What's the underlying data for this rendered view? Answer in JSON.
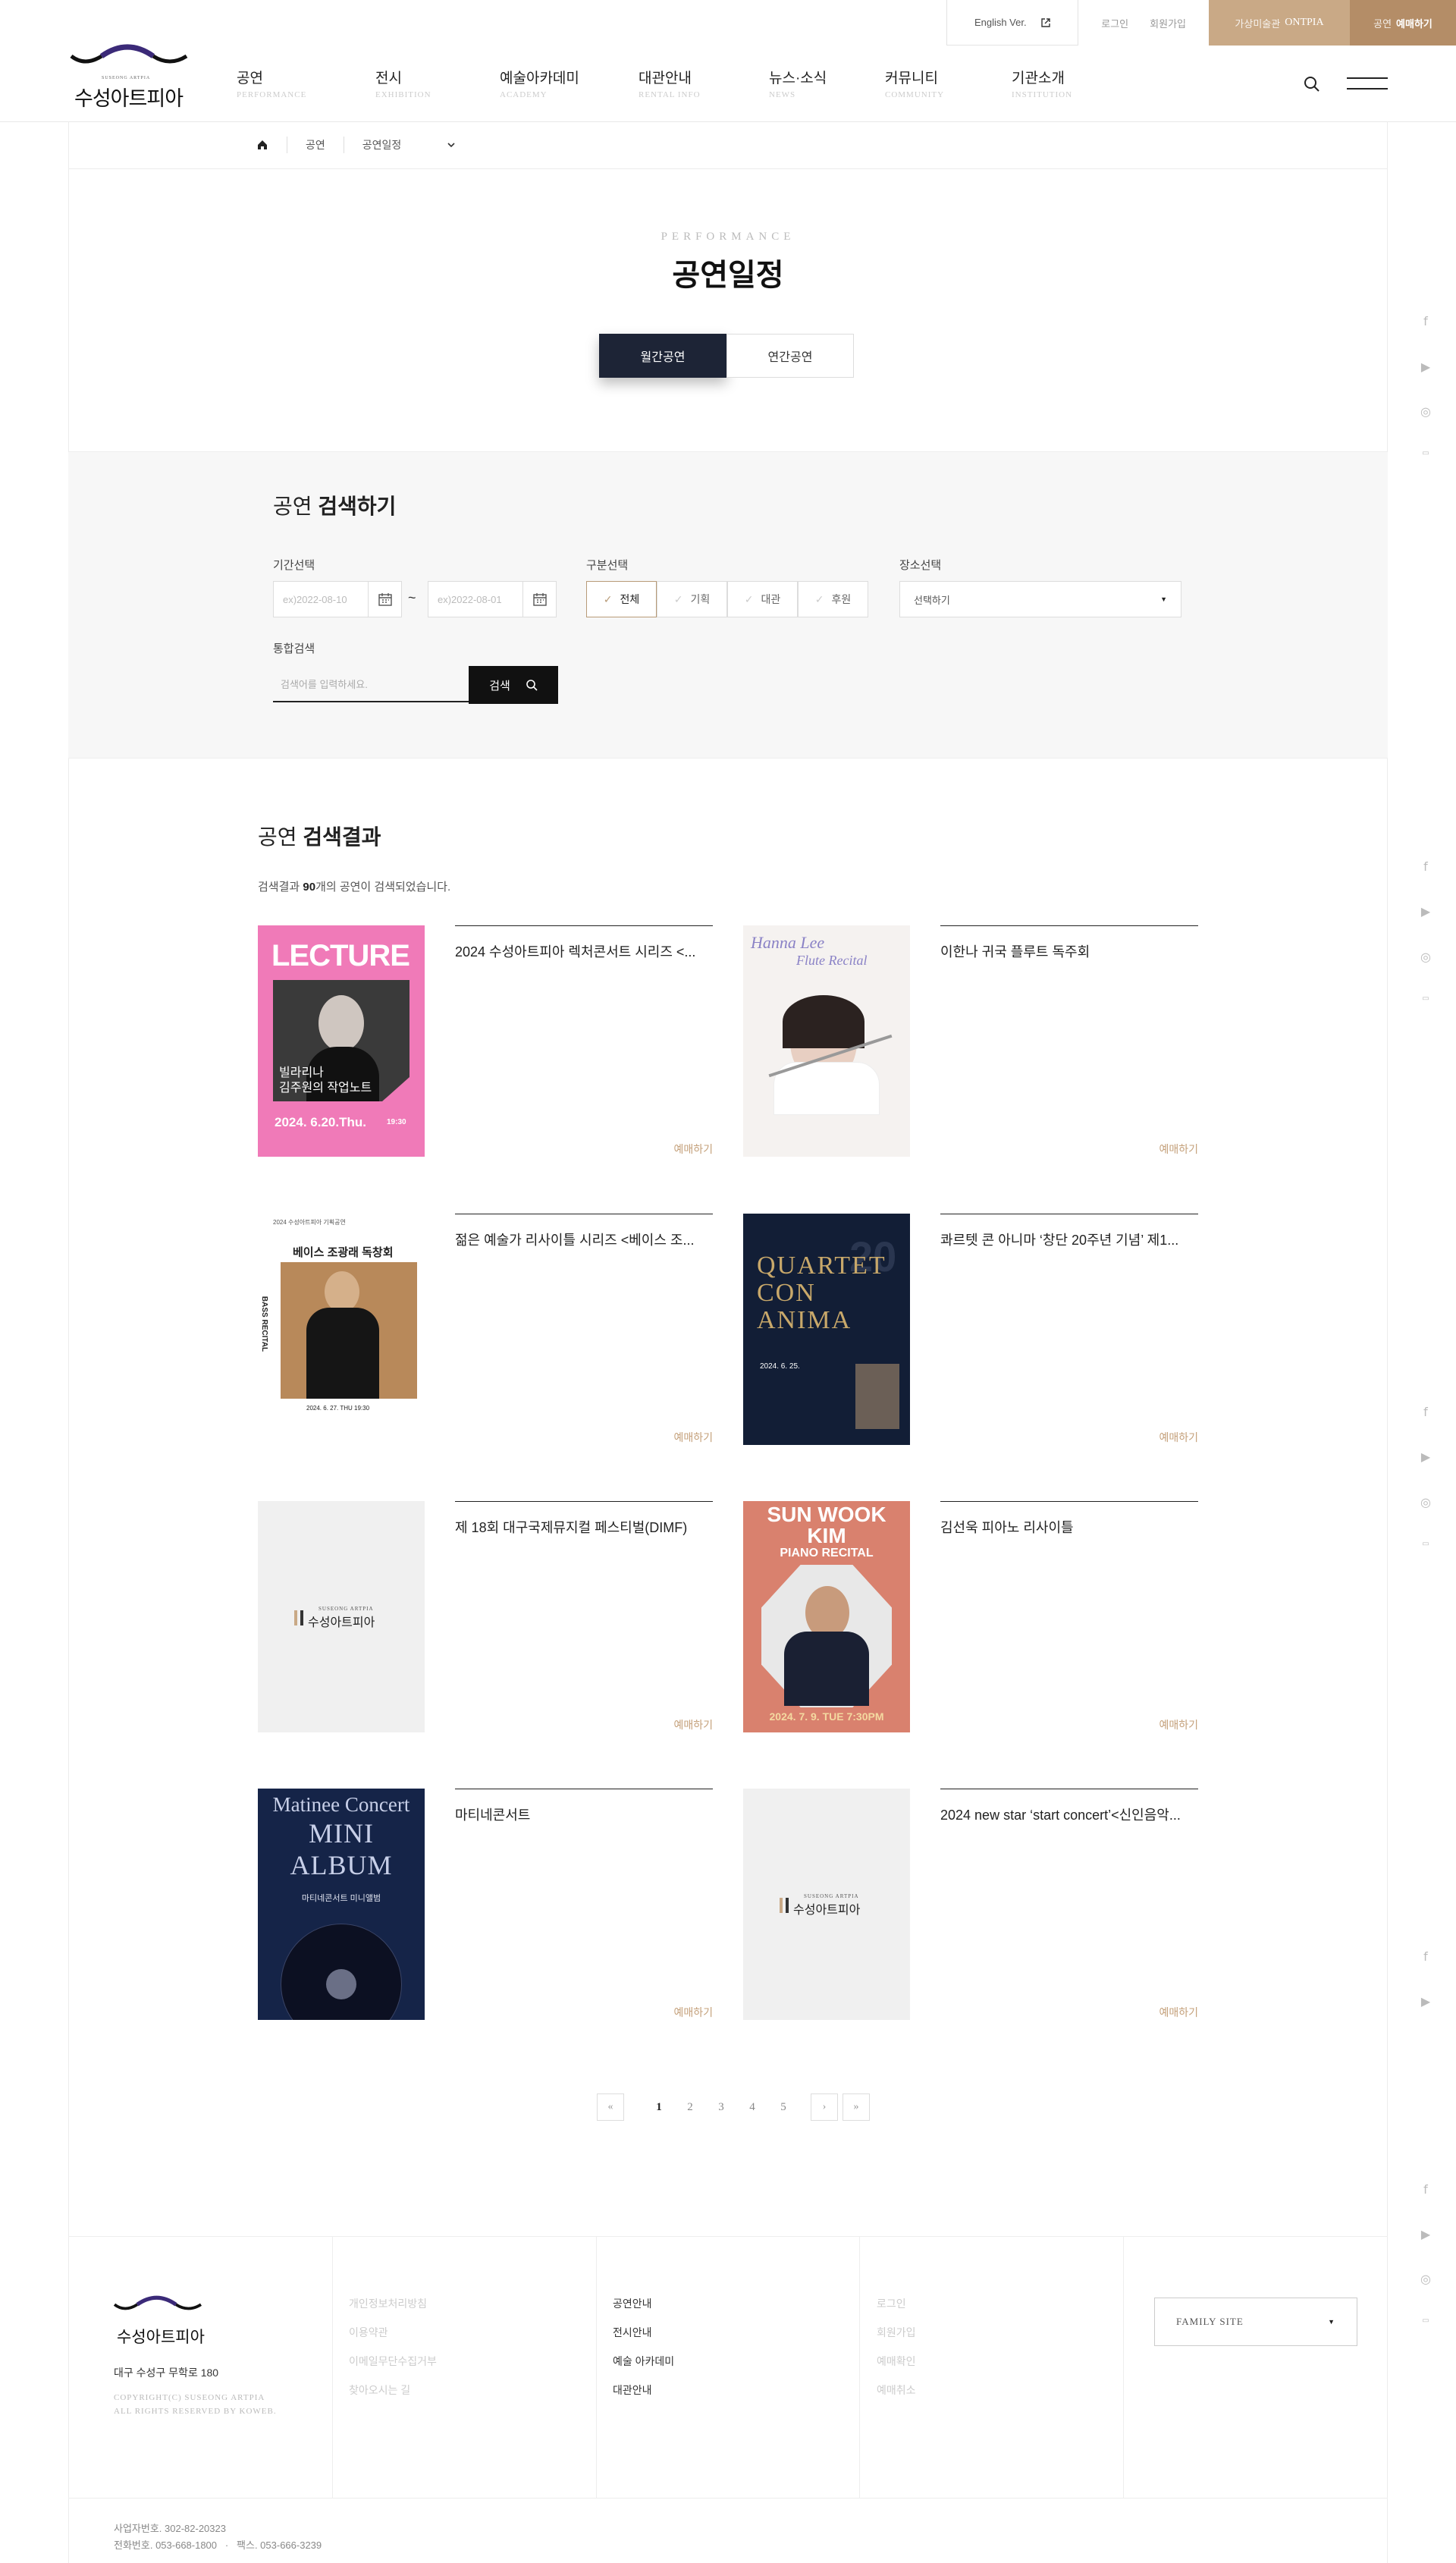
{
  "util": {
    "english": "English Ver.",
    "login": "로그인",
    "join": "회원가입",
    "ontpia_prefix": "가상미술관",
    "ontpia": "ONTPIA",
    "book_prefix": "공연",
    "book": "예매하기"
  },
  "logo": {
    "sub": "SUSEONG ARTPIA",
    "name": "수성아트피아"
  },
  "nav": [
    {
      "ko": "공연",
      "en": "PERFORMANCE"
    },
    {
      "ko": "전시",
      "en": "EXHIBITION"
    },
    {
      "ko": "예술아카데미",
      "en": "ACADEMY"
    },
    {
      "ko": "대관안내",
      "en": "RENTAL INFO"
    },
    {
      "ko": "뉴스·소식",
      "en": "NEWS"
    },
    {
      "ko": "커뮤니티",
      "en": "COMMUNITY"
    },
    {
      "ko": "기관소개",
      "en": "INSTITUTION"
    }
  ],
  "breadcrumb": {
    "level1": "공연",
    "level2": "공연일정"
  },
  "page": {
    "title_en": "PERFORMANCE",
    "title": "공연일정"
  },
  "tabs": [
    "월간공연",
    "연간공연"
  ],
  "search": {
    "title_light": "공연",
    "title_bold": "검색하기",
    "period_label": "기간선택",
    "date_from": "ex)2022-08-10",
    "date_to": "ex)2022-08-01",
    "tilde": "~",
    "type_label": "구분선택",
    "types": [
      "전체",
      "기획",
      "대관",
      "후원"
    ],
    "venue_label": "장소선택",
    "venue_value": "선택하기",
    "keyword_label": "통합검색",
    "keyword_placeholder": "검색어를 입력하세요.",
    "button": "검색"
  },
  "results": {
    "title_light": "공연",
    "title_bold": "검색결과",
    "count_prefix": "검색결과",
    "count": "90",
    "count_suffix": "개의 공연이 검색되었습니다.",
    "book_label": "예매하기",
    "items": [
      {
        "title": "2024 수성아트피아 렉처콘서트 시리즈 <..."
      },
      {
        "title": "이한나 귀국 플루트 독주회"
      },
      {
        "title": "젊은 예술가 리사이틀 시리즈 <베이스 조..."
      },
      {
        "title": "콰르텟 콘 아니마 ‘창단 20주년 기념’ 제1..."
      },
      {
        "title": "제 18회 대구국제뮤지컬 페스티벌(DIMF)"
      },
      {
        "title": "김선욱 피아노 리사이틀"
      },
      {
        "title": "마티네콘서트"
      },
      {
        "title": "2024 new star ‘start concert’<신인음악..."
      }
    ]
  },
  "posters": {
    "p1": {
      "head": "LECTURE",
      "line1": "빌라리나",
      "line2": "김주원의 작업노트",
      "date": "2024. 6.20.Thu.",
      "time": "19:30"
    },
    "p2": {
      "script1": "Hanna Lee",
      "script2": "Flute Recital"
    },
    "p3": {
      "top": "2024 수성아트피아 기획공연",
      "title": "베이스 조광래 독창회",
      "side": "BASS RECITAL",
      "date": "2024. 6. 27. THU 19:30"
    },
    "p4": {
      "num": "20",
      "l1": "QUARTET",
      "l2": "CON",
      "l3": "ANIMA",
      "date": "2024. 6. 25."
    },
    "p6": {
      "l1": "SUN WOOK",
      "l2": "KIM",
      "l3": "PIANO RECITAL",
      "date": "2024. 7. 9. TUE 7:30PM"
    },
    "p7": {
      "l1": "Matinee Concert",
      "l2": "MINI ALBUM",
      "l3": "마티네콘서트 미니앨범"
    }
  },
  "pager": {
    "first": "«",
    "prev": "‹",
    "pages": [
      "1",
      "2",
      "3",
      "4",
      "5"
    ],
    "next": "›",
    "last": "»"
  },
  "footer": {
    "address": "대구 수성구 무학로 180",
    "copyright1": "COPYRIGHT(C) SUSEONG ARTPIA",
    "copyright2": "ALL RIGHTS RESERVED BY KOWEB.",
    "col1": [
      "개인정보처리방침",
      "이용약관",
      "이메일무단수집거부",
      "찾아오시는 길"
    ],
    "col2": [
      "공연안내",
      "전시안내",
      "예술 아카데미",
      "대관안내"
    ],
    "col3": [
      "로그인",
      "회원가입",
      "예매확인",
      "예매취소"
    ],
    "family_site": "FAMILY SITE",
    "biz": "사업자번호. 302-82-20323",
    "tel": "전화번호. 053-668-1800",
    "fax": "팩스. 053-666-3239"
  },
  "colors": {
    "accent": "#b48d67",
    "dark": "#1d2436",
    "link_gold": "#c4a07a"
  },
  "icons": [
    "home-icon",
    "chevron-down-icon",
    "search-icon",
    "menu-icon",
    "calendar-icon",
    "external-link-icon",
    "facebook-icon",
    "youtube-icon",
    "instagram-icon",
    "blog-icon"
  ]
}
